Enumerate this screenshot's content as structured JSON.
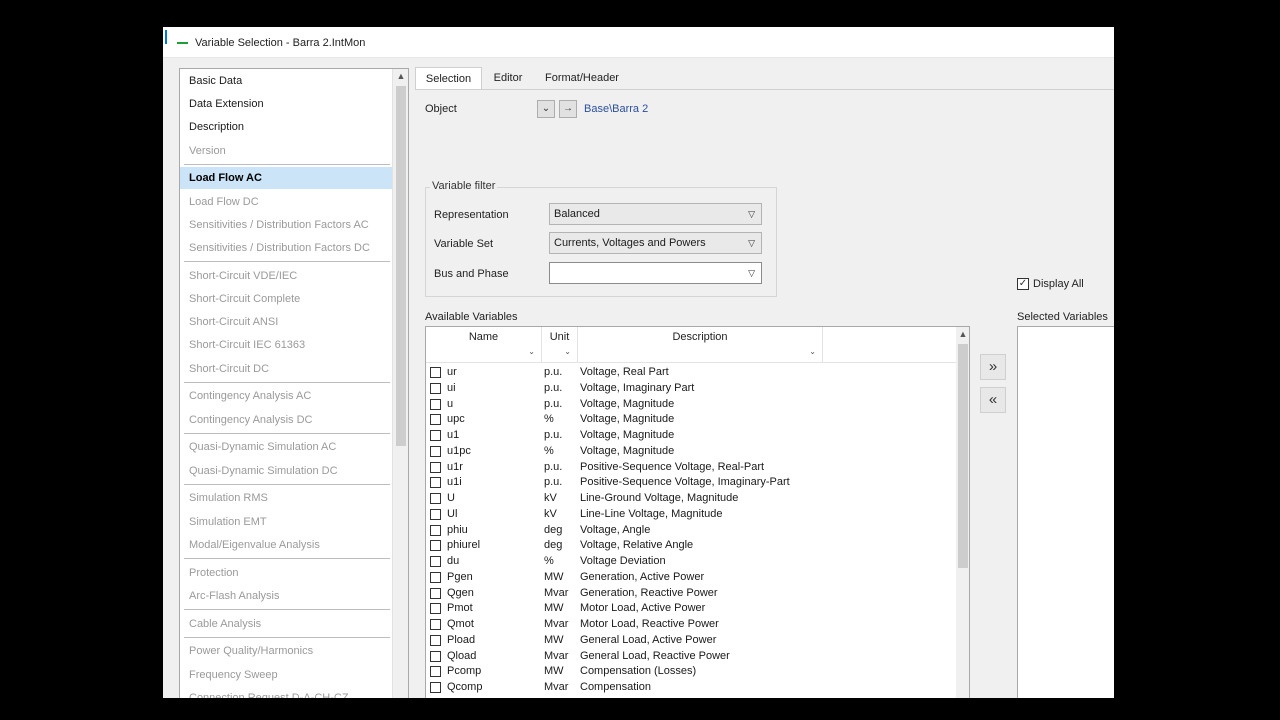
{
  "window": {
    "title": "Variable Selection - Barra 2.IntMon"
  },
  "nav": {
    "items": [
      {
        "label": "Basic Data",
        "enabled": true
      },
      {
        "label": "Data Extension",
        "enabled": true
      },
      {
        "label": "Description",
        "enabled": true
      },
      {
        "label": "Version",
        "enabled": false
      },
      {
        "label": "Load Flow AC",
        "enabled": true,
        "active": true
      },
      {
        "label": "Load Flow DC",
        "enabled": false
      },
      {
        "label": "Sensitivities / Distribution Factors AC",
        "enabled": false
      },
      {
        "label": "Sensitivities / Distribution Factors DC",
        "enabled": false
      },
      {
        "label": "Short-Circuit VDE/IEC",
        "enabled": false
      },
      {
        "label": "Short-Circuit Complete",
        "enabled": false
      },
      {
        "label": "Short-Circuit ANSI",
        "enabled": false
      },
      {
        "label": "Short-Circuit IEC 61363",
        "enabled": false
      },
      {
        "label": "Short-Circuit DC",
        "enabled": false
      },
      {
        "label": "Contingency Analysis AC",
        "enabled": false
      },
      {
        "label": "Contingency Analysis DC",
        "enabled": false
      },
      {
        "label": "Quasi-Dynamic Simulation AC",
        "enabled": false
      },
      {
        "label": "Quasi-Dynamic Simulation DC",
        "enabled": false
      },
      {
        "label": "Simulation RMS",
        "enabled": false
      },
      {
        "label": "Simulation EMT",
        "enabled": false
      },
      {
        "label": "Modal/Eigenvalue Analysis",
        "enabled": false
      },
      {
        "label": "Protection",
        "enabled": false
      },
      {
        "label": "Arc-Flash Analysis",
        "enabled": false
      },
      {
        "label": "Cable Analysis",
        "enabled": false
      },
      {
        "label": "Power Quality/Harmonics",
        "enabled": false
      },
      {
        "label": "Frequency Sweep",
        "enabled": false
      },
      {
        "label": "Connection Request D-A-CH-CZ",
        "enabled": false
      }
    ]
  },
  "tabs": [
    {
      "label": "Selection",
      "active": true
    },
    {
      "label": "Editor",
      "active": false
    },
    {
      "label": "Format/Header",
      "active": false
    }
  ],
  "object": {
    "label": "Object",
    "path": "Base\\Barra 2"
  },
  "filter": {
    "title": "Variable filter",
    "representation_label": "Representation",
    "representation_value": "Balanced",
    "variable_set_label": "Variable Set",
    "variable_set_value": "Currents, Voltages and Powers",
    "bus_phase_label": "Bus and Phase",
    "bus_phase_value": ""
  },
  "display_all": {
    "label": "Display All",
    "checked": true
  },
  "available": {
    "title": "Available Variables",
    "columns": {
      "name": "Name",
      "unit": "Unit",
      "description": "Description"
    },
    "rows": [
      {
        "name": "ur",
        "unit": "p.u.",
        "description": "Voltage, Real Part"
      },
      {
        "name": "ui",
        "unit": "p.u.",
        "description": "Voltage, Imaginary Part"
      },
      {
        "name": "u",
        "unit": "p.u.",
        "description": "Voltage, Magnitude"
      },
      {
        "name": "upc",
        "unit": "%",
        "description": "Voltage, Magnitude"
      },
      {
        "name": "u1",
        "unit": "p.u.",
        "description": "Voltage, Magnitude"
      },
      {
        "name": "u1pc",
        "unit": "%",
        "description": "Voltage, Magnitude"
      },
      {
        "name": "u1r",
        "unit": "p.u.",
        "description": "Positive-Sequence Voltage, Real-Part"
      },
      {
        "name": "u1i",
        "unit": "p.u.",
        "description": "Positive-Sequence Voltage, Imaginary-Part"
      },
      {
        "name": "U",
        "unit": "kV",
        "description": "Line-Ground Voltage, Magnitude"
      },
      {
        "name": "Ul",
        "unit": "kV",
        "description": "Line-Line Voltage, Magnitude"
      },
      {
        "name": "phiu",
        "unit": "deg",
        "description": "Voltage, Angle"
      },
      {
        "name": "phiurel",
        "unit": "deg",
        "description": "Voltage, Relative Angle"
      },
      {
        "name": "du",
        "unit": "%",
        "description": "Voltage Deviation"
      },
      {
        "name": "Pgen",
        "unit": "MW",
        "description": "Generation, Active Power"
      },
      {
        "name": "Qgen",
        "unit": "Mvar",
        "description": "Generation, Reactive Power"
      },
      {
        "name": "Pmot",
        "unit": "MW",
        "description": "Motor Load, Active Power"
      },
      {
        "name": "Qmot",
        "unit": "Mvar",
        "description": "Motor Load, Reactive Power"
      },
      {
        "name": "Pload",
        "unit": "MW",
        "description": "General Load, Active Power"
      },
      {
        "name": "Qload",
        "unit": "Mvar",
        "description": "General Load, Reactive Power"
      },
      {
        "name": "Pcomp",
        "unit": "MW",
        "description": "Compensation (Losses)"
      },
      {
        "name": "Qcomp",
        "unit": "Mvar",
        "description": "Compensation"
      }
    ]
  },
  "selected": {
    "title": "Selected Variables"
  },
  "buttons": {
    "add": "»",
    "remove": "«"
  }
}
